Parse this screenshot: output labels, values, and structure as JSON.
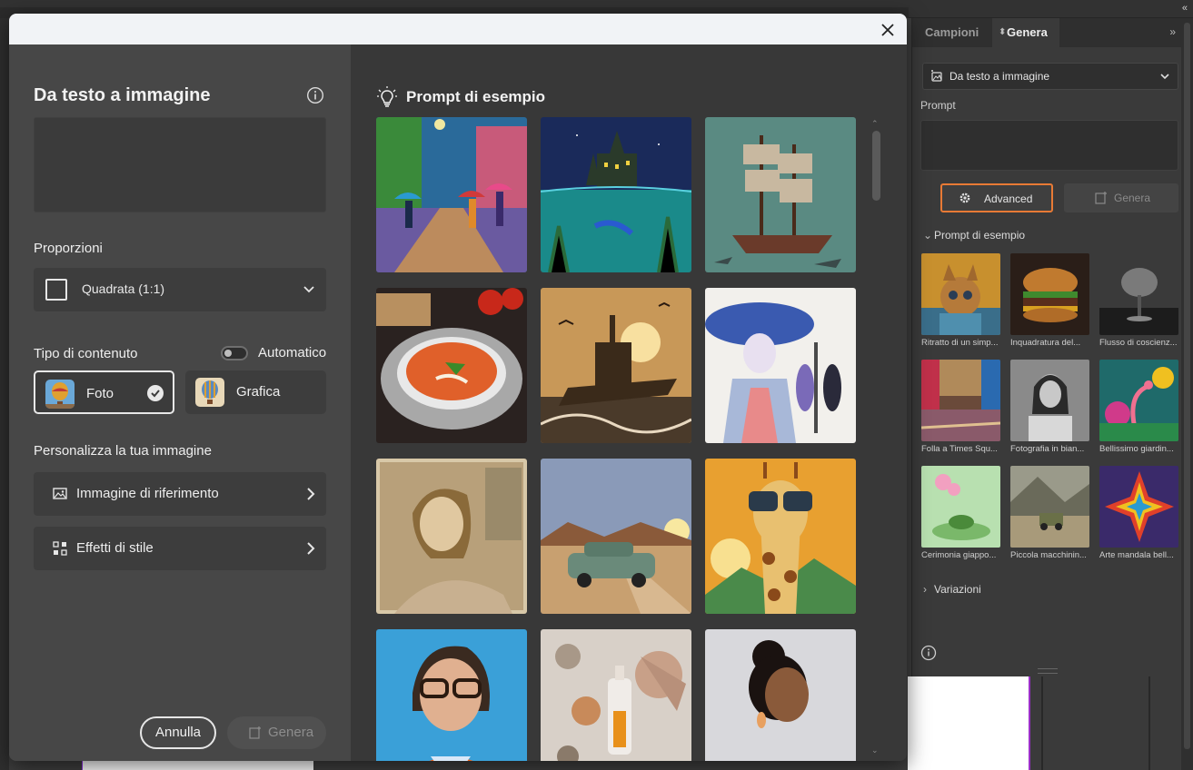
{
  "dialog": {
    "title": "Da testo a immagine",
    "prompt_value": "",
    "proportions": {
      "label": "Proporzioni",
      "selected": "Quadrata (1:1)"
    },
    "content_type": {
      "label": "Tipo di contenuto",
      "auto_label": "Automatico",
      "auto_enabled": false,
      "options": [
        {
          "label": "Foto",
          "selected": true
        },
        {
          "label": "Grafica",
          "selected": false
        }
      ]
    },
    "customize": {
      "label": "Personalizza la tua immagine",
      "items": [
        {
          "label": "Immagine di riferimento",
          "icon": "reference-image-icon"
        },
        {
          "label": "Effetti di stile",
          "icon": "style-effects-icon"
        }
      ]
    },
    "buttons": {
      "cancel": "Annulla",
      "generate": "Genera"
    },
    "examples_title": "Prompt di esempio",
    "gallery": [
      {
        "subject": "rainy street painting with umbrellas"
      },
      {
        "subject": "castle above underwater mermaid"
      },
      {
        "subject": "sunken sailing ship with sharks"
      },
      {
        "subject": "tomato soup bowl"
      },
      {
        "subject": "battleship at sunset with birds"
      },
      {
        "subject": "watercolor woman with hat"
      },
      {
        "subject": "sepia portrait of smiling woman"
      },
      {
        "subject": "vintage car on desert road"
      },
      {
        "subject": "giraffe with sunglasses"
      },
      {
        "subject": "3D cartoon woman with glasses"
      },
      {
        "subject": "seashells and bottle"
      },
      {
        "subject": "woman with earring portrait"
      }
    ]
  },
  "side_panel": {
    "tabs": [
      {
        "label": "Campioni",
        "active": false
      },
      {
        "label": "Genera",
        "active": true
      }
    ],
    "mode_select": "Da testo a immagine",
    "prompt_label": "Prompt",
    "advanced_button": "Advanced",
    "generate_button": "Genera",
    "examples_label": "Prompt di esempio",
    "thumbnails": [
      {
        "caption": "Ritratto di un simp..."
      },
      {
        "caption": "Inquadratura del..."
      },
      {
        "caption": "Flusso di coscienz..."
      },
      {
        "caption": "Folla a Times Squ..."
      },
      {
        "caption": "Fotografia in bian..."
      },
      {
        "caption": "Bellissimo giardin..."
      },
      {
        "caption": "Cerimonia giappo..."
      },
      {
        "caption": "Piccola macchinin..."
      },
      {
        "caption": "Arte mandala bell..."
      }
    ],
    "variations_label": "Variazioni"
  },
  "colors": {
    "advanced_outline": "#e87a35",
    "dialog_header": "#f1f3f6",
    "dialog_left_bg": "#474747",
    "dialog_right_bg": "#383838",
    "panel_bg": "#3a3a3a"
  }
}
